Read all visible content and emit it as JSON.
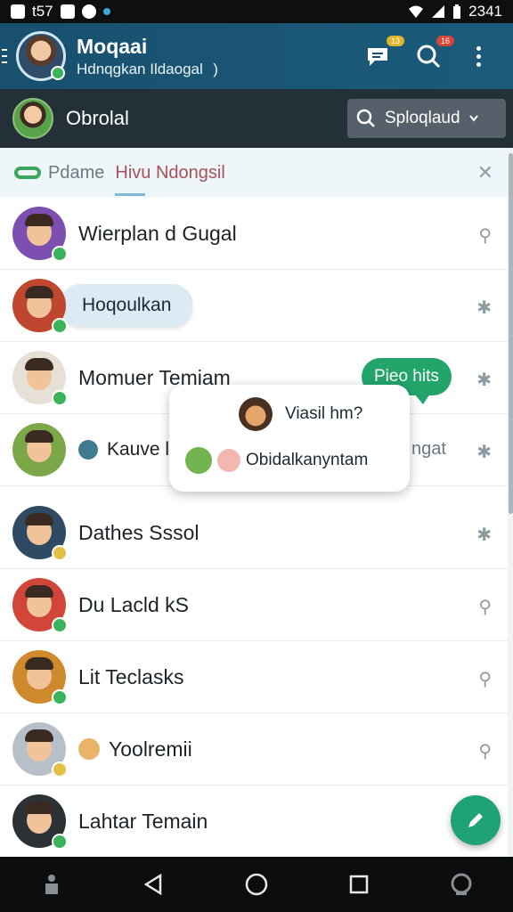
{
  "status_bar": {
    "left_text": "t57",
    "time": "2341"
  },
  "app_bar": {
    "title": "Moqaai",
    "subtitle": "Hdnqgkan Ildaogal   )",
    "chat_badge": "13",
    "search_badge": "16"
  },
  "bar2": {
    "label": "Obrolal",
    "search_text": "Sploqlaud"
  },
  "chips": {
    "chip1": "Pdame",
    "chip2": "Hivu Ndongsil"
  },
  "rows": [
    {
      "name": "Wierplan d Gugal"
    },
    {
      "name": "Hoqoulkan"
    },
    {
      "name": "Momuer Temiam",
      "bubble": "Pieo hits"
    },
    {
      "name": "Kauve l",
      "trail_text": "ngat"
    },
    {
      "name": "Dathes Sssol"
    },
    {
      "name": "Du Lacld kS"
    },
    {
      "name": "Lit Teclasks"
    },
    {
      "name": "Yoolremii"
    },
    {
      "name": "Lahtar Temain"
    }
  ],
  "popup": {
    "line1": "Viasil hm?",
    "line2": "Obidalkanyntam"
  },
  "colors": {
    "app_bar": "#1b5b7a",
    "accent_green": "#22a46a",
    "fab": "#1fa374"
  }
}
